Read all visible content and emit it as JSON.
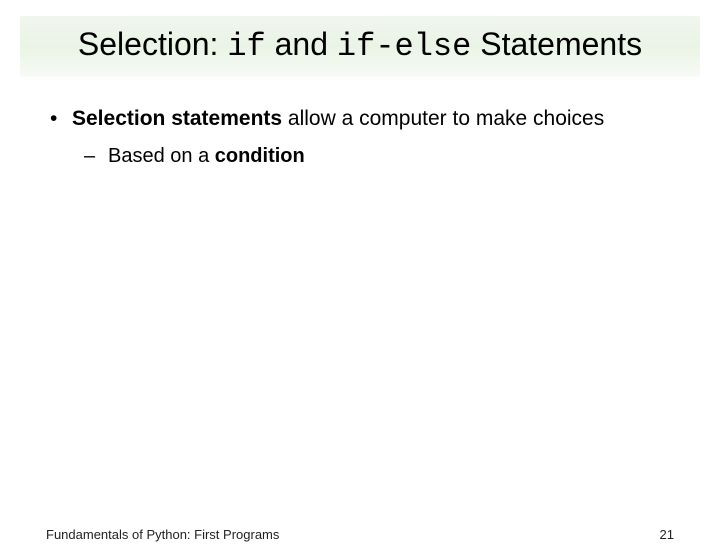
{
  "title": {
    "pre": "Selection: ",
    "code1": "if",
    "mid": " and ",
    "code2": "if-else",
    "post": " Statements"
  },
  "bullets": {
    "b1": {
      "strong": "Selection statements",
      "rest": " allow a computer to make choices",
      "sub": {
        "pre": "Based on a ",
        "strong": "condition"
      }
    }
  },
  "footer": {
    "left": "Fundamentals of Python: First Programs",
    "right": "21"
  }
}
